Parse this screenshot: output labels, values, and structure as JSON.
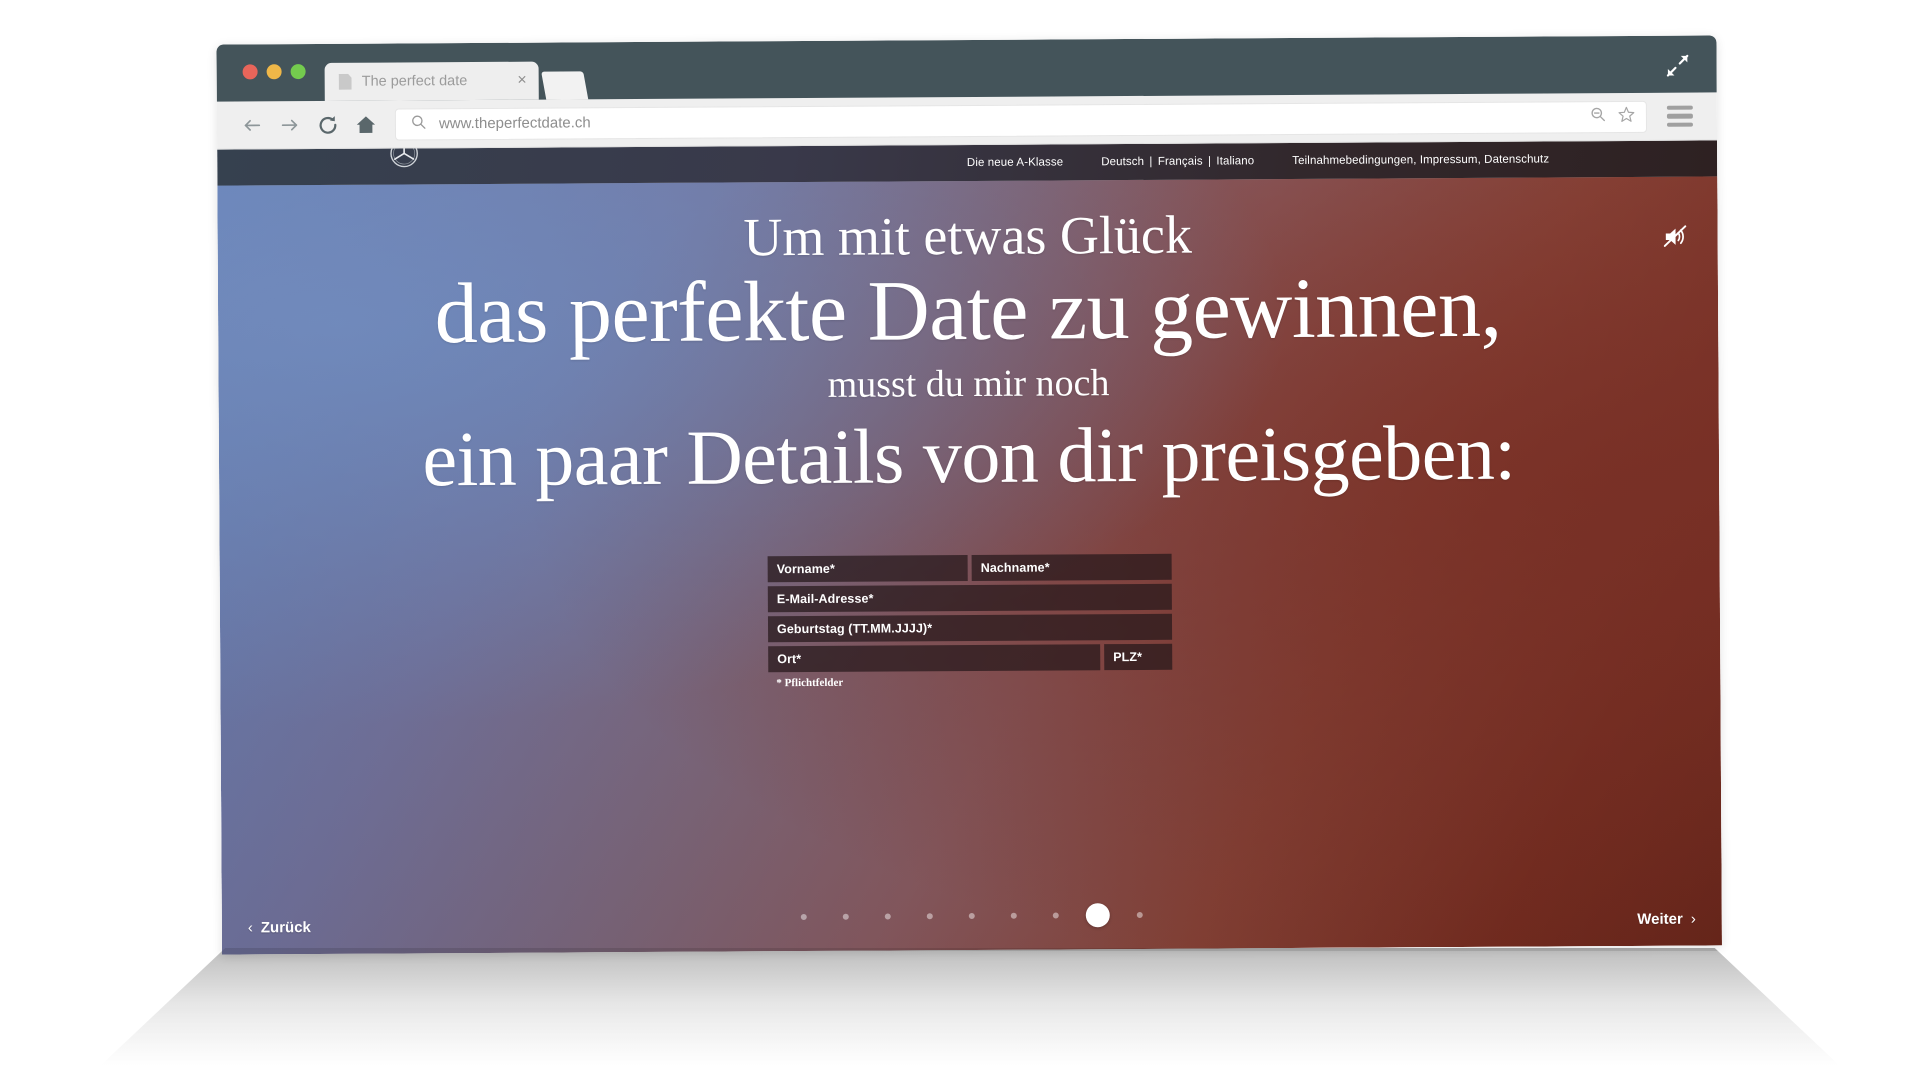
{
  "browser": {
    "tab": {
      "title": "The perfect date",
      "close_label": "×",
      "icon": "page-icon"
    },
    "new_tab_label": "",
    "expand_icon": "fullscreen-icon",
    "toolbar": {
      "back_icon": "back-arrow-icon",
      "forward_icon": "forward-arrow-icon",
      "reload_icon": "reload-icon",
      "home_icon": "home-icon",
      "search_icon": "search-icon",
      "url": "www.theperfectdate.ch",
      "zoom_out_icon": "zoom-out-icon",
      "bookmark_icon": "star-icon",
      "menu_icon": "hamburger-menu-icon"
    }
  },
  "site": {
    "header": {
      "logo": "mercedes-benz-star-logo",
      "campaign_link": "Die neue A-Klasse",
      "languages": [
        "Deutsch",
        "Français",
        "Italiano"
      ],
      "lang_separator": "|",
      "legal_link": "Teilnahmebedingungen, Impressum, Datenschutz"
    },
    "hero": {
      "mute_icon": "sound-muted-icon",
      "headline_line1": "Um mit etwas Glück",
      "headline_line2": "das perfekte Date zu gewinnen,",
      "headline_line3": "musst du mir noch",
      "headline_line4": "ein paar Details von dir preisgeben:"
    },
    "form": {
      "first_name": {
        "label": "Vorname*",
        "value": ""
      },
      "last_name": {
        "label": "Nachname*",
        "value": ""
      },
      "email": {
        "label": "E-Mail-Adresse*",
        "value": ""
      },
      "birthday": {
        "label": "Geburtstag (TT.MM.JJJJ)*",
        "value": ""
      },
      "city": {
        "label": "Ort*",
        "value": ""
      },
      "zip": {
        "label": "PLZ*",
        "value": ""
      },
      "required_note": "* Pflichtfelder"
    },
    "footer": {
      "back_label": "Zurück",
      "back_chevron": "‹",
      "next_label": "Weiter",
      "next_chevron": "›",
      "dots_total": 9,
      "active_dot_index": 7
    }
  },
  "colors": {
    "titlebar": "#44545a",
    "toolbar": "#efefef",
    "site_header": "#32282c",
    "hero_blue": "#5c7bb4",
    "hero_red": "#7b2e21",
    "field_bg": "rgba(38,24,26,0.72)"
  }
}
